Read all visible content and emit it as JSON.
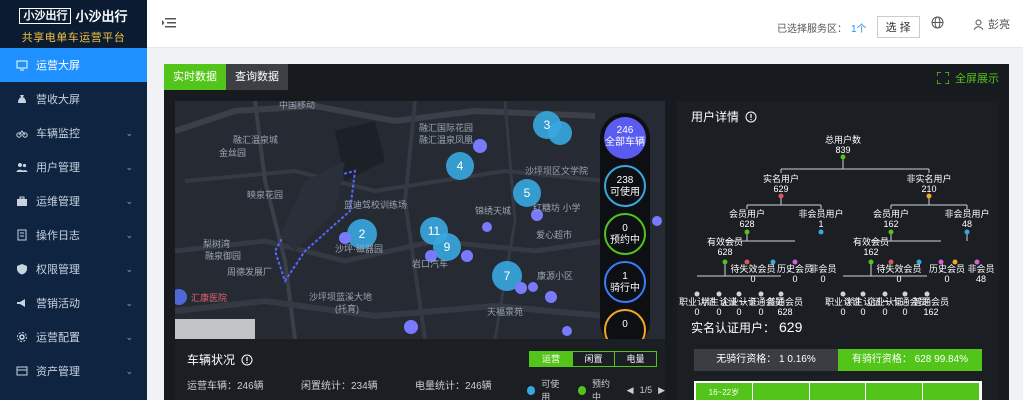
{
  "logo": {
    "brand_box": "小沙出行",
    "brand_text": "小沙出行",
    "subtitle": "共享电单车运营平台"
  },
  "sidebar": {
    "items": [
      {
        "label": "运营大屏",
        "icon": "monitor-icon",
        "active": true,
        "has_children": false
      },
      {
        "label": "营收大屏",
        "icon": "money-bag-icon",
        "active": false,
        "has_children": false
      },
      {
        "label": "车辆监控",
        "icon": "bike-icon",
        "active": false,
        "has_children": true
      },
      {
        "label": "用户管理",
        "icon": "users-icon",
        "active": false,
        "has_children": true
      },
      {
        "label": "运维管理",
        "icon": "toolbox-icon",
        "active": false,
        "has_children": true
      },
      {
        "label": "操作日志",
        "icon": "log-icon",
        "active": false,
        "has_children": true
      },
      {
        "label": "权限管理",
        "icon": "shield-icon",
        "active": false,
        "has_children": true
      },
      {
        "label": "营销活动",
        "icon": "campaign-icon",
        "active": false,
        "has_children": true
      },
      {
        "label": "运营配置",
        "icon": "config-icon",
        "active": false,
        "has_children": true
      },
      {
        "label": "资产管理",
        "icon": "asset-icon",
        "active": false,
        "has_children": true
      }
    ]
  },
  "header": {
    "service_area_label": "已选择服务区：",
    "service_area_count": "1个",
    "select_button": "选 择",
    "user_name": "彭亮"
  },
  "tabs": [
    {
      "label": "实时数据",
      "active": true
    },
    {
      "label": "查询数据",
      "active": false
    }
  ],
  "fullscreen_label": "全屏展示",
  "map": {
    "place_labels": [
      "中国移动",
      "融汇国际花园",
      "融汇温泉凤凰",
      "融汇温泉城",
      "金丝园",
      "映泉花园",
      "沙坪坝区文学院",
      "锦绣天城",
      "红糖坊 小学",
      "蓝迪驾校训练场",
      "梨树湾",
      "融泉御园",
      "沙坪·磁器园",
      "岩口汽车",
      "爱心超市",
      "周德发展厂",
      "沙坪坝蓝溪大地",
      "(托育)",
      "康源小区",
      "天福景苑",
      "汇康医院"
    ],
    "clusters": [
      "3",
      "4",
      "5",
      "2",
      "11",
      "9",
      "7"
    ],
    "stats": [
      {
        "value": "246",
        "label": "全部车辆"
      },
      {
        "value": "238",
        "label": "可使用"
      },
      {
        "value": "0",
        "label": "预约中"
      },
      {
        "value": "1",
        "label": "骑行中"
      },
      {
        "value": "0",
        "label": ""
      }
    ]
  },
  "vehicle": {
    "title": "车辆状况",
    "tabs": [
      "运营",
      "闲置",
      "电量"
    ],
    "operating": "运营车辆：246辆",
    "idle": "闲置统计：234辆",
    "battery": "电量统计：246辆",
    "legend_available": "可使用",
    "legend_reserved": "预约中",
    "page": "1/5"
  },
  "user_detail": {
    "title": "用户详情",
    "tree": {
      "total": {
        "label": "总用户数",
        "value": "839"
      },
      "real": {
        "label": "实名用户",
        "value": "629"
      },
      "unreal": {
        "label": "非实名用户",
        "value": "210"
      },
      "real_member": {
        "label": "会员用户",
        "value": "628"
      },
      "real_nonmember": {
        "label": "非会员用户",
        "value": "1"
      },
      "un_member": {
        "label": "会员用户",
        "value": "162"
      },
      "un_nonmember": {
        "label": "非会员用户",
        "value": "48"
      },
      "real_valid": {
        "label": "有效会员",
        "value": "628"
      },
      "real_lost": {
        "label": "待失效会员",
        "value": "0"
      },
      "real_hist": {
        "label": "历史会员",
        "value": "0"
      },
      "real_never": {
        "label": "非会员",
        "value": "0"
      },
      "un_valid": {
        "label": "有效会员",
        "value": "162"
      },
      "un_lost": {
        "label": "待失效会员",
        "value": "0"
      },
      "un_hist": {
        "label": "历史会员",
        "value": "0"
      },
      "un_never": {
        "label": "非会员",
        "value": "48"
      },
      "leaf_l": [
        "职业认证",
        "学生认证",
        "企业认证",
        "一卡通会员",
        "普通会员"
      ],
      "leaf_l_vals": [
        "0",
        "0",
        "0",
        "0",
        "628"
      ],
      "leaf_r": [
        "职业认证",
        "学生认证",
        "企业认证",
        "一卡通会员",
        "普通会员"
      ],
      "leaf_r_vals": [
        "0",
        "0",
        "0",
        "0",
        "162"
      ]
    },
    "realname_label": "实名认证用户：",
    "realname_value": "629",
    "no_qual": "无骑行资格： 1  0.16%",
    "has_qual": "有骑行资格： 628  99.84%",
    "age_bins": [
      "16~22岁",
      "",
      "",
      "",
      ""
    ]
  }
}
